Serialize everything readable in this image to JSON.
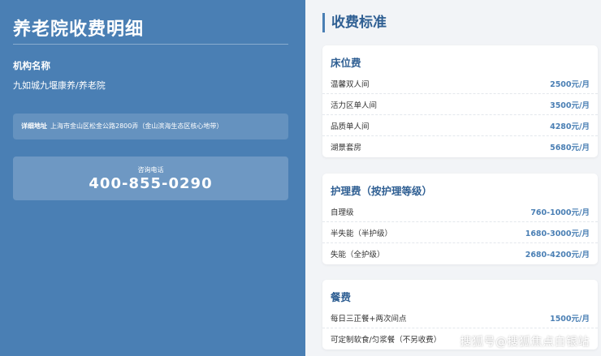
{
  "left": {
    "title": "养老院收费明细",
    "org_label": "机构名称",
    "org_name": "九如城九堰康养/养老院",
    "address_label": "详细地址",
    "address_value": "上海市金山区松金公路2800弄（金山滨海生态区核心地带）",
    "phone_label": "咨询电话",
    "phone_number": "400-855-0290"
  },
  "right": {
    "section_title": "收费标准",
    "cards": [
      {
        "title": "床位费",
        "rows": [
          {
            "name": "温馨双人间",
            "price": "2500元/月"
          },
          {
            "name": "活力区单人间",
            "price": "3500元/月"
          },
          {
            "name": "品质单人间",
            "price": "4280元/月"
          },
          {
            "name": "湖景套房",
            "price": "5680元/月"
          }
        ]
      },
      {
        "title": "护理费（按护理等级）",
        "rows": [
          {
            "name": "自理级",
            "price": "760-1000元/月"
          },
          {
            "name": "半失能（半护级）",
            "price": "1680-3000元/月"
          },
          {
            "name": "失能（全护级）",
            "price": "2680-4200元/月"
          }
        ]
      },
      {
        "title": "餐费",
        "rows": [
          {
            "name": "每日三正餐+两次间点",
            "price": "1500元/月"
          },
          {
            "name": "可定制软食/匀浆餐（不另收费）",
            "price": ""
          }
        ]
      }
    ]
  },
  "watermark": "搜狐号@搜狐焦点白银站",
  "colors": {
    "panel_blue": "#4a7fb4",
    "title_blue": "#2f5f93",
    "background": "#f2f4f7"
  }
}
